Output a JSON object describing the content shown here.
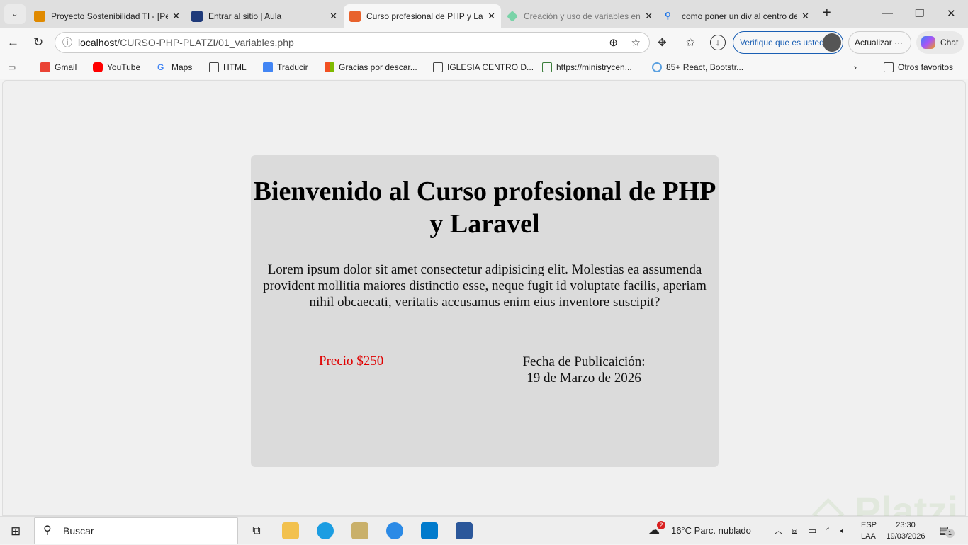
{
  "tabs": [
    {
      "title": "Proyecto Sostenibilidad TI - [Pe",
      "icon_color": "#e08a00"
    },
    {
      "title": "Entrar al sitio | Aula",
      "icon_color": "#1f3a7a"
    },
    {
      "title": "Curso profesional de PHP y Lara",
      "icon_color": "#e8622c",
      "active": true
    },
    {
      "title": "Creación y uso de variables en",
      "icon_color": "#7ad3a8"
    },
    {
      "title": "como poner un div al centro de",
      "icon_color": "#1a73e8"
    }
  ],
  "address": {
    "host": "localhost",
    "path": "/CURSO-PHP-PLATZI/01_variables.php"
  },
  "toolbar": {
    "verify": "Verifique que es usted",
    "update": "Actualizar",
    "more": "···",
    "chat": "Chat"
  },
  "bookmarks": [
    {
      "label": "Gmail",
      "color": "#ea4335"
    },
    {
      "label": "YouTube",
      "color": "#ff0000"
    },
    {
      "label": "Maps",
      "color": "#4285f4"
    },
    {
      "label": "HTML",
      "color": "folder"
    },
    {
      "label": "Traducir",
      "color": "#4285f4"
    },
    {
      "label": "Gracias por descar...",
      "color": "#f25022"
    },
    {
      "label": "IGLESIA CENTRO D...",
      "color": "folder"
    },
    {
      "label": "https://ministrycen...",
      "color": "#3a7d3a"
    },
    {
      "label": "85+ React, Bootstr...",
      "color": "#5aa0e0"
    }
  ],
  "other_favorites": "Otros favoritos",
  "card": {
    "title": "Bienvenido al Curso profesional de PHP y Laravel",
    "body": "Lorem ipsum dolor sit amet consectetur adipisicing elit. Molestias ea assumenda provident mollitia maiores distinctio esse, neque fugit id voluptate facilis, aperiam nihil obcaecati, veritatis accusamus enim eius inventore suscipit?",
    "price": "Precio $250",
    "date_label": "Fecha de Publicaición:",
    "date_value": "19 de Marzo de 2026"
  },
  "taskbar": {
    "search": "Buscar",
    "weather": "16°C  Parc. nublado",
    "weather_badge": "2",
    "lang1": "ESP",
    "lang2": "LAA",
    "time": "23:30",
    "date": "19/03/2026",
    "notif": "1"
  },
  "watermark": "Platzi"
}
